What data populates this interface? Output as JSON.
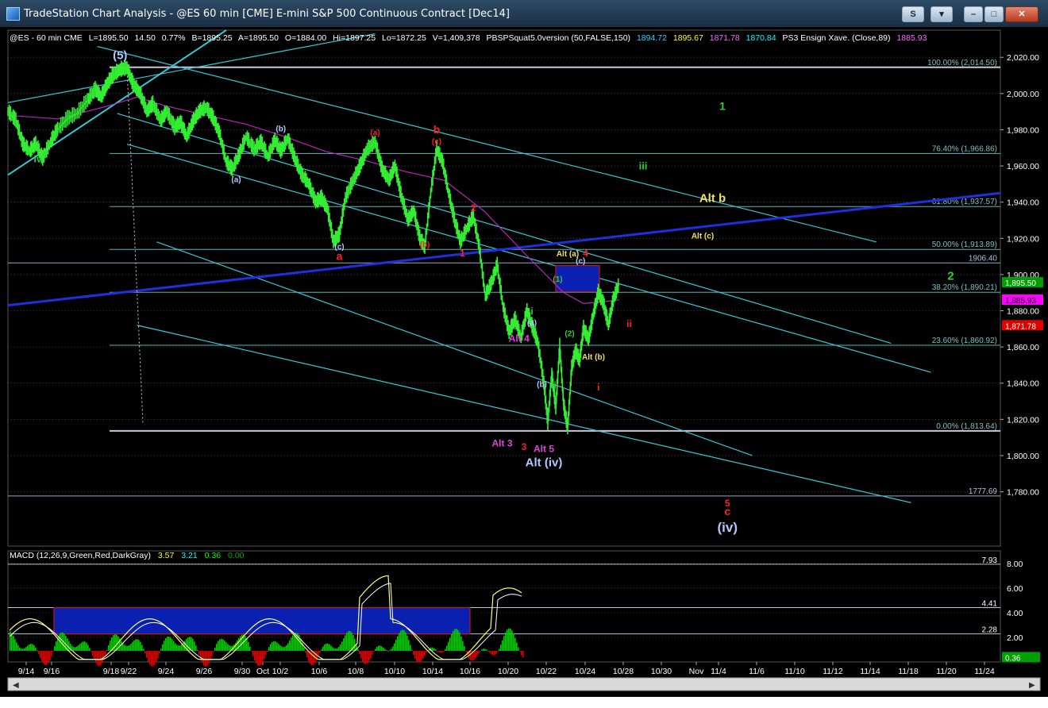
{
  "window": {
    "title": "TradeStation Chart Analysis - @ES 60 min [CME] E-mini S&P 500 Continuous Contract [Dec14]",
    "buttons": {
      "s": "S",
      "menu": "▾",
      "min": "–",
      "max": "□",
      "close": "✕"
    }
  },
  "header": {
    "symbol": "@ES - 60 min  CME",
    "last": "L=1895.50",
    "chg": "14.50",
    "pct": "0.77%",
    "bid": "B=1895.25",
    "ask": "A=1895.50",
    "open": "O=1884.00",
    "high": "Hi=1897.25",
    "low": "Lo=1872.25",
    "vol": "V=1,409,378",
    "ind1": "PBSPSquat5.0version (50,FALSE,150)",
    "ind1_v1": "1894.72",
    "ind1_v2": "1895.67",
    "ind1_v3": "1871.78",
    "ind1_v4": "1870.84",
    "ind2": "PS3 Ensign Xave. (Close,89)",
    "ind2_v": "1885.93"
  },
  "macd": {
    "label": "MACD (12,26,9,Green,Red,DarkGray)",
    "v1": "3.57",
    "v2": "3.21",
    "v3": "0.36",
    "v4": "0.00",
    "ylim": [
      0,
      8.5
    ],
    "ticks": [
      "8.00",
      "6.00",
      "4.00",
      "2.00"
    ],
    "levels": [
      "7.93",
      "4.41",
      "2.28"
    ],
    "hist_label": "0.36"
  },
  "colors": {
    "price": "#33ee33",
    "average": "#c020c0",
    "channel": "#33c9d9",
    "blue_trend": "#1e2fe0",
    "grid": "#666666",
    "red_label": "#ff2020",
    "green_label": "#32cd32",
    "yellow_label": "#f0e060",
    "magenta_label": "#e040e0",
    "white_label": "#b0c8ff"
  },
  "chart_data": {
    "type": "line",
    "title": "@ES 60 min E-mini S&P 500 Continuous Contract [Dec14]",
    "ylim": [
      1750,
      2035
    ],
    "y_ticks": [
      "2,020.00",
      "2,000.00",
      "1,980.00",
      "1,960.00",
      "1,940.00",
      "1,920.00",
      "1,900.00",
      "1,880.00",
      "1,860.00",
      "1,840.00",
      "1,820.00",
      "1,800.00",
      "1,780.00"
    ],
    "x_ticks": [
      "9/14",
      "9/16",
      "9/18",
      "9/22",
      "9/24",
      "9/26",
      "9/30",
      "Oct",
      "10/2",
      "10/6",
      "10/8",
      "10/10",
      "10/14",
      "10/16",
      "10/20",
      "10/22",
      "10/24",
      "10/28",
      "10/30",
      "Nov",
      "11/4",
      "11/6",
      "11/10",
      "11/12",
      "11/14",
      "11/18",
      "11/20",
      "11/24"
    ],
    "price_series": [
      {
        "t": 0,
        "v": 1990
      },
      {
        "t": 0.8,
        "v": 1985
      },
      {
        "t": 1.5,
        "v": 1972
      },
      {
        "t": 2.2,
        "v": 1968
      },
      {
        "t": 2.8,
        "v": 1972
      },
      {
        "t": 3.5,
        "v": 1964
      },
      {
        "t": 4.3,
        "v": 1973
      },
      {
        "t": 5.0,
        "v": 1980
      },
      {
        "t": 6.0,
        "v": 1986
      },
      {
        "t": 7.0,
        "v": 1989
      },
      {
        "t": 8.0,
        "v": 1996
      },
      {
        "t": 8.8,
        "v": 2002
      },
      {
        "t": 9.4,
        "v": 1998
      },
      {
        "t": 10.0,
        "v": 2005
      },
      {
        "t": 10.6,
        "v": 2010
      },
      {
        "t": 11.3,
        "v": 2013
      },
      {
        "t": 12.0,
        "v": 2014
      },
      {
        "t": 12.6,
        "v": 2005
      },
      {
        "t": 13.3,
        "v": 2000
      },
      {
        "t": 14.0,
        "v": 1990
      },
      {
        "t": 14.6,
        "v": 1994
      },
      {
        "t": 15.4,
        "v": 1985
      },
      {
        "t": 16.0,
        "v": 1990
      },
      {
        "t": 16.8,
        "v": 1981
      },
      {
        "t": 17.4,
        "v": 1984
      },
      {
        "t": 18.0,
        "v": 1976
      },
      {
        "t": 18.7,
        "v": 1985
      },
      {
        "t": 19.3,
        "v": 1990
      },
      {
        "t": 20.0,
        "v": 1992
      },
      {
        "t": 20.7,
        "v": 1986
      },
      {
        "t": 21.3,
        "v": 1978
      },
      {
        "t": 22.0,
        "v": 1962
      },
      {
        "t": 22.6,
        "v": 1958
      },
      {
        "t": 23.3,
        "v": 1966
      },
      {
        "t": 24.0,
        "v": 1976
      },
      {
        "t": 24.8,
        "v": 1969
      },
      {
        "t": 25.5,
        "v": 1973
      },
      {
        "t": 26.2,
        "v": 1965
      },
      {
        "t": 26.9,
        "v": 1974
      },
      {
        "t": 27.5,
        "v": 1968
      },
      {
        "t": 28.2,
        "v": 1975
      },
      {
        "t": 28.9,
        "v": 1964
      },
      {
        "t": 29.6,
        "v": 1955
      },
      {
        "t": 30.3,
        "v": 1950
      },
      {
        "t": 31.0,
        "v": 1940
      },
      {
        "t": 31.6,
        "v": 1942
      },
      {
        "t": 32.2,
        "v": 1936
      },
      {
        "t": 32.8,
        "v": 1918
      },
      {
        "t": 33.4,
        "v": 1922
      },
      {
        "t": 34.0,
        "v": 1942
      },
      {
        "t": 34.8,
        "v": 1952
      },
      {
        "t": 35.5,
        "v": 1960
      },
      {
        "t": 36.2,
        "v": 1969
      },
      {
        "t": 37.0,
        "v": 1973
      },
      {
        "t": 37.7,
        "v": 1958
      },
      {
        "t": 38.4,
        "v": 1952
      },
      {
        "t": 39.0,
        "v": 1960
      },
      {
        "t": 39.6,
        "v": 1944
      },
      {
        "t": 40.3,
        "v": 1930
      },
      {
        "t": 40.9,
        "v": 1935
      },
      {
        "t": 41.5,
        "v": 1920
      },
      {
        "t": 42.0,
        "v": 1915
      },
      {
        "t": 42.6,
        "v": 1945
      },
      {
        "t": 43.2,
        "v": 1969
      },
      {
        "t": 43.8,
        "v": 1962
      },
      {
        "t": 44.4,
        "v": 1945
      },
      {
        "t": 45.0,
        "v": 1930
      },
      {
        "t": 45.6,
        "v": 1918
      },
      {
        "t": 46.3,
        "v": 1926
      },
      {
        "t": 46.9,
        "v": 1932
      },
      {
        "t": 47.5,
        "v": 1915
      },
      {
        "t": 48.1,
        "v": 1888
      },
      {
        "t": 48.7,
        "v": 1895
      },
      {
        "t": 49.3,
        "v": 1905
      },
      {
        "t": 49.9,
        "v": 1882
      },
      {
        "t": 50.5,
        "v": 1868
      },
      {
        "t": 51.1,
        "v": 1875
      },
      {
        "t": 51.7,
        "v": 1865
      },
      {
        "t": 52.3,
        "v": 1880
      },
      {
        "t": 52.9,
        "v": 1870
      },
      {
        "t": 53.4,
        "v": 1862
      },
      {
        "t": 54.0,
        "v": 1840
      },
      {
        "t": 54.4,
        "v": 1818
      },
      {
        "t": 54.8,
        "v": 1845
      },
      {
        "t": 55.2,
        "v": 1826
      },
      {
        "t": 55.6,
        "v": 1860
      },
      {
        "t": 56.0,
        "v": 1828
      },
      {
        "t": 56.4,
        "v": 1815
      },
      {
        "t": 56.8,
        "v": 1848
      },
      {
        "t": 57.2,
        "v": 1858
      },
      {
        "t": 57.6,
        "v": 1852
      },
      {
        "t": 58.0,
        "v": 1870
      },
      {
        "t": 58.5,
        "v": 1864
      },
      {
        "t": 59.0,
        "v": 1878
      },
      {
        "t": 59.5,
        "v": 1890
      },
      {
        "t": 60.0,
        "v": 1884
      },
      {
        "t": 60.5,
        "v": 1872
      },
      {
        "t": 61.0,
        "v": 1886
      },
      {
        "t": 61.6,
        "v": 1895
      }
    ],
    "average_series": [
      {
        "t": 0,
        "v": 1988
      },
      {
        "t": 5,
        "v": 1986
      },
      {
        "t": 10,
        "v": 1993
      },
      {
        "t": 13,
        "v": 1998
      },
      {
        "t": 16,
        "v": 1993
      },
      {
        "t": 20,
        "v": 1988
      },
      {
        "t": 24,
        "v": 1983
      },
      {
        "t": 28,
        "v": 1976
      },
      {
        "t": 32,
        "v": 1968
      },
      {
        "t": 36,
        "v": 1963
      },
      {
        "t": 40,
        "v": 1957
      },
      {
        "t": 44,
        "v": 1952
      },
      {
        "t": 48,
        "v": 1935
      },
      {
        "t": 52,
        "v": 1912
      },
      {
        "t": 56,
        "v": 1890
      },
      {
        "t": 58,
        "v": 1884
      },
      {
        "t": 60,
        "v": 1885
      },
      {
        "t": 61.6,
        "v": 1886
      }
    ],
    "fib_levels": [
      {
        "label": "100.00% (2,014.50)",
        "value": 2014.5
      },
      {
        "label": "76.40% (1,966.86)",
        "value": 1966.86
      },
      {
        "label": "61.80% (1,937.57)",
        "value": 1937.57
      },
      {
        "label": "50.00% (1,913.89)",
        "value": 1913.89
      },
      {
        "label": "38.20% (1,890.21)",
        "value": 1890.21
      },
      {
        "label": "23.60% (1,860.92)",
        "value": 1860.92
      },
      {
        "label": "0.00% (1,813.64)",
        "value": 1813.64
      }
    ],
    "horizontal_levels": [
      {
        "label": "1906.40",
        "value": 1906.4
      },
      {
        "label": "1777.69",
        "value": 1777.69
      }
    ],
    "price_badges": [
      {
        "label": "1,895.50",
        "value": 1895.5,
        "bg": "#00a000",
        "fg": "#ffffff"
      },
      {
        "label": "1,885.93",
        "value": 1885.93,
        "bg": "#ff00ff",
        "fg": "#000000"
      },
      {
        "label": "1,871.78",
        "value": 1871.78,
        "bg": "#e00000",
        "fg": "#ffffff"
      }
    ],
    "wave_labels": [
      {
        "text": "(5)",
        "t": 11.3,
        "v": 2019,
        "color": "white_label",
        "size": 15
      },
      {
        "text": "iv",
        "t": 3.0,
        "v": 1962,
        "color": "green_label",
        "size": 12
      },
      {
        "text": "(b)",
        "t": 27.5,
        "v": 1979,
        "color": "white_label",
        "size": 10
      },
      {
        "text": "(a)",
        "t": 23.0,
        "v": 1951,
        "color": "white_label",
        "size": 10
      },
      {
        "text": "(c)",
        "t": 33.4,
        "v": 1914,
        "color": "white_label",
        "size": 10
      },
      {
        "text": "a",
        "t": 33.4,
        "v": 1908,
        "color": "red_label",
        "size": 14
      },
      {
        "text": "(a)",
        "t": 37.0,
        "v": 1977,
        "color": "red_label",
        "size": 10
      },
      {
        "text": "b",
        "t": 43.2,
        "v": 1978,
        "color": "red_label",
        "size": 14
      },
      {
        "text": "(c)",
        "t": 43.2,
        "v": 1972,
        "color": "red_label",
        "size": 10
      },
      {
        "text": "(b)",
        "t": 42.0,
        "v": 1915,
        "color": "red_label",
        "size": 10
      },
      {
        "text": "2",
        "t": 46.9,
        "v": 1935,
        "color": "red_label",
        "size": 12
      },
      {
        "text": "1",
        "t": 45.8,
        "v": 1910,
        "color": "red_label",
        "size": 12
      },
      {
        "text": "1",
        "t": 72.0,
        "v": 1991,
        "color": "green_label",
        "size": 14
      },
      {
        "text": "iii",
        "t": 64.0,
        "v": 1958,
        "color": "green_label",
        "size": 13
      },
      {
        "text": "Alt b",
        "t": 71.0,
        "v": 1940,
        "color": "yellow_label",
        "size": 15
      },
      {
        "text": "Alt (c)",
        "t": 70.0,
        "v": 1920,
        "color": "yellow_label",
        "size": 10
      },
      {
        "text": "Alt (a)",
        "t": 56.4,
        "v": 1910,
        "color": "yellow_label",
        "size": 10
      },
      {
        "text": "4",
        "t": 58.2,
        "v": 1910,
        "color": "red_label",
        "size": 12
      },
      {
        "text": "(c)",
        "t": 57.7,
        "v": 1906,
        "color": "white_label",
        "size": 10
      },
      {
        "text": "2",
        "t": 95.0,
        "v": 1897,
        "color": "green_label",
        "size": 15
      },
      {
        "text": "(1)",
        "t": 55.4,
        "v": 1896,
        "color": "green_label",
        "size": 10
      },
      {
        "text": "(2)",
        "t": 56.6,
        "v": 1866,
        "color": "green_label",
        "size": 10
      },
      {
        "text": "ii",
        "t": 62.6,
        "v": 1871,
        "color": "red_label",
        "size": 12
      },
      {
        "text": "i",
        "t": 52.8,
        "v": 1878,
        "color": "green_label",
        "size": 12
      },
      {
        "text": "(a)",
        "t": 52.8,
        "v": 1872,
        "color": "white_label",
        "size": 10
      },
      {
        "text": "Alt 4",
        "t": 51.5,
        "v": 1863,
        "color": "magenta_label",
        "size": 12
      },
      {
        "text": "Alt (b)",
        "t": 59.0,
        "v": 1853,
        "color": "yellow_label",
        "size": 10
      },
      {
        "text": "(b)",
        "t": 53.8,
        "v": 1838,
        "color": "white_label",
        "size": 10
      },
      {
        "text": "ii",
        "t": 55.0,
        "v": 1837,
        "color": "green_label",
        "size": 12
      },
      {
        "text": "i",
        "t": 59.5,
        "v": 1836,
        "color": "red_label",
        "size": 12
      },
      {
        "text": "Alt 3",
        "t": 49.8,
        "v": 1805,
        "color": "magenta_label",
        "size": 12
      },
      {
        "text": "3",
        "t": 52.0,
        "v": 1803,
        "color": "red_label",
        "size": 12
      },
      {
        "text": "Alt 5",
        "t": 54.0,
        "v": 1802,
        "color": "magenta_label",
        "size": 12
      },
      {
        "text": "Alt (iv)",
        "t": 54.0,
        "v": 1794,
        "color": "white_label",
        "size": 15
      },
      {
        "text": "5",
        "t": 72.5,
        "v": 1772,
        "color": "red_label",
        "size": 12
      },
      {
        "text": "c",
        "t": 72.5,
        "v": 1767,
        "color": "red_label",
        "size": 14
      },
      {
        "text": "(iv)",
        "t": 72.5,
        "v": 1758,
        "color": "white_label",
        "size": 17
      }
    ]
  }
}
